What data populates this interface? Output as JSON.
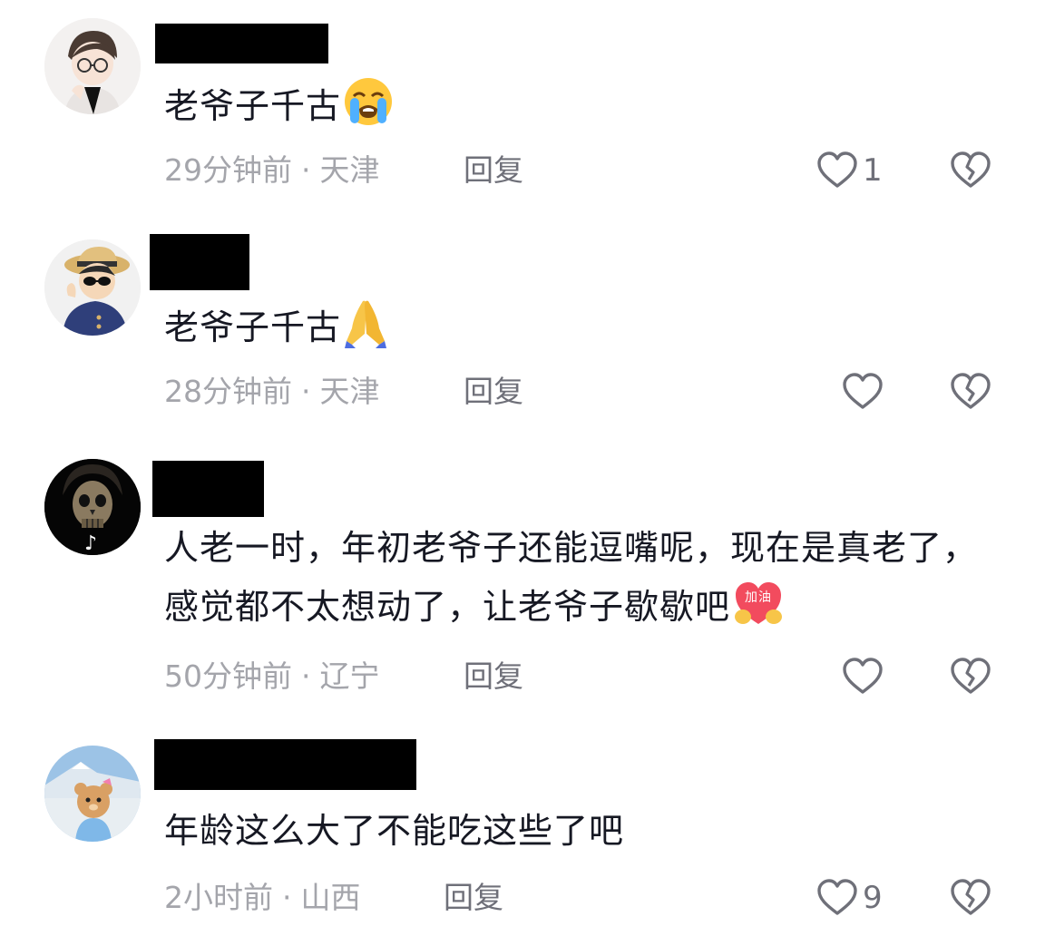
{
  "comments": [
    {
      "text": "老爷子千古",
      "emoji": "loudly-crying-face",
      "time": "29分钟前",
      "separator": "·",
      "location": "天津",
      "reply": "回复",
      "likes": "1"
    },
    {
      "text": "老爷子千古",
      "emoji": "folded-hands",
      "time": "28分钟前",
      "separator": "·",
      "location": "天津",
      "reply": "回复",
      "likes": ""
    },
    {
      "text": "人老一时，年初老爷子还能逗嘴呢，现在是真老了，感觉都不太想动了，让老爷子歇歇吧",
      "emoji": "jiayou-heart",
      "emoji_label": "加油",
      "time": "50分钟前",
      "separator": "·",
      "location": "辽宁",
      "reply": "回复",
      "likes": ""
    },
    {
      "text": "年龄这么大了不能吃这些了吧",
      "time": "2小时前",
      "separator": "·",
      "location": "山西",
      "reply": "回复",
      "likes": "9"
    }
  ],
  "icons": {
    "like": "heart-outline-icon",
    "dislike": "broken-heart-outline-icon"
  },
  "colors": {
    "text": "#161823",
    "meta": "#a4a5ab",
    "reply": "#6f7079",
    "icon": "#6f7079",
    "redaction": "#000000"
  }
}
